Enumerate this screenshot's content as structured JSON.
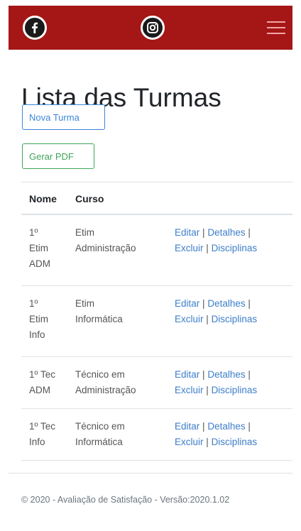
{
  "navbar": {
    "bg_color": "#a51616",
    "icons": [
      "facebook-icon",
      "instagram-icon",
      "menu-icon"
    ]
  },
  "page": {
    "title": "Lista das Turmas"
  },
  "buttons": {
    "new_label": "Nova Turma",
    "pdf_label": "Gerar PDF"
  },
  "table": {
    "headers": [
      "Nome",
      "Curso"
    ],
    "action_labels": {
      "edit": "Editar",
      "details": "Detalhes",
      "delete": "Excluir",
      "disciplines": "Disciplinas",
      "separator": "|"
    },
    "rows": [
      {
        "nome": [
          "1º",
          "Etim",
          "ADM"
        ],
        "curso": [
          "Etim",
          "Administração"
        ]
      },
      {
        "nome": [
          "1º",
          "Etim",
          "Info"
        ],
        "curso": [
          "Etim",
          "Informática"
        ]
      },
      {
        "nome": [
          "1º Tec",
          "ADM"
        ],
        "curso": [
          "Técnico em",
          "Administração"
        ]
      },
      {
        "nome": [
          "1º Tec",
          "Info"
        ],
        "curso": [
          "Técnico em",
          "Informática"
        ]
      }
    ]
  },
  "footer": {
    "text": "© 2020 - Avaliação de Satisfação - Versão:2020.1.02"
  },
  "colors": {
    "primary": "#3d86d8",
    "success": "#3fa458",
    "link": "#3d7ec9"
  }
}
